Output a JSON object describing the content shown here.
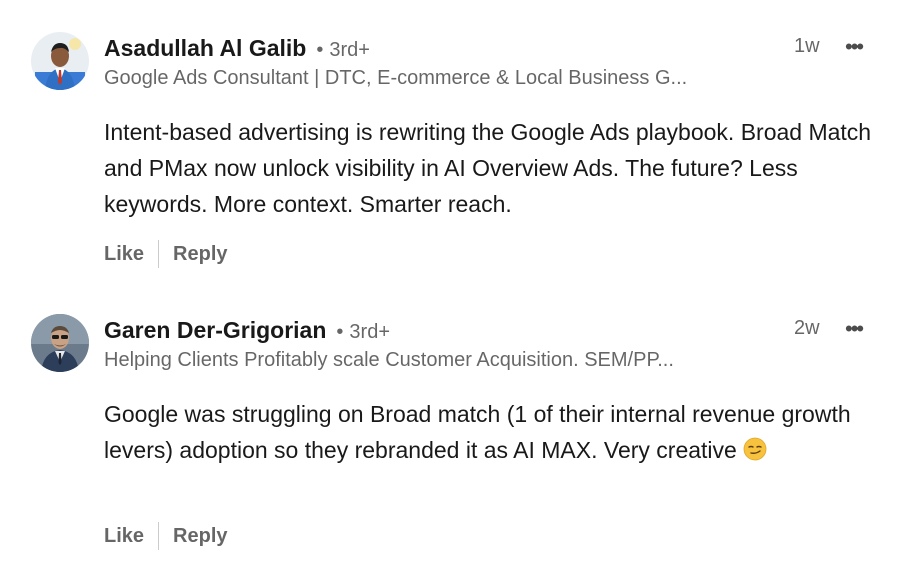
{
  "comments": [
    {
      "author": "Asadullah Al Galib",
      "degree_dot": "•",
      "degree": "3rd+",
      "headline": "Google Ads Consultant | DTC, E-commerce & Local Business G...",
      "time": "1w",
      "more_label": "•••",
      "text": "Intent-based advertising is rewriting the Google Ads playbook. Broad Match and PMax now unlock visibility in AI Overview Ads. The future? Less keywords. More context. Smarter reach.",
      "like_label": "Like",
      "reply_label": "Reply",
      "avatar_icon": "profile-photo"
    },
    {
      "author": "Garen Der-Grigorian",
      "degree_dot": "•",
      "degree": "3rd+",
      "headline": "Helping Clients Profitably scale Customer Acquisition. SEM/PP...",
      "time": "2w",
      "more_label": "•••",
      "text": "Google was struggling on Broad match (1 of their internal revenue growth levers) adoption so they rebranded it as AI MAX. Very creative",
      "emoji_icon": "smirking-face-emoji",
      "like_label": "Like",
      "reply_label": "Reply",
      "avatar_icon": "profile-photo"
    }
  ],
  "colors": {
    "primary_text": "#191919",
    "secondary_text": "#666666",
    "background": "#ffffff"
  }
}
